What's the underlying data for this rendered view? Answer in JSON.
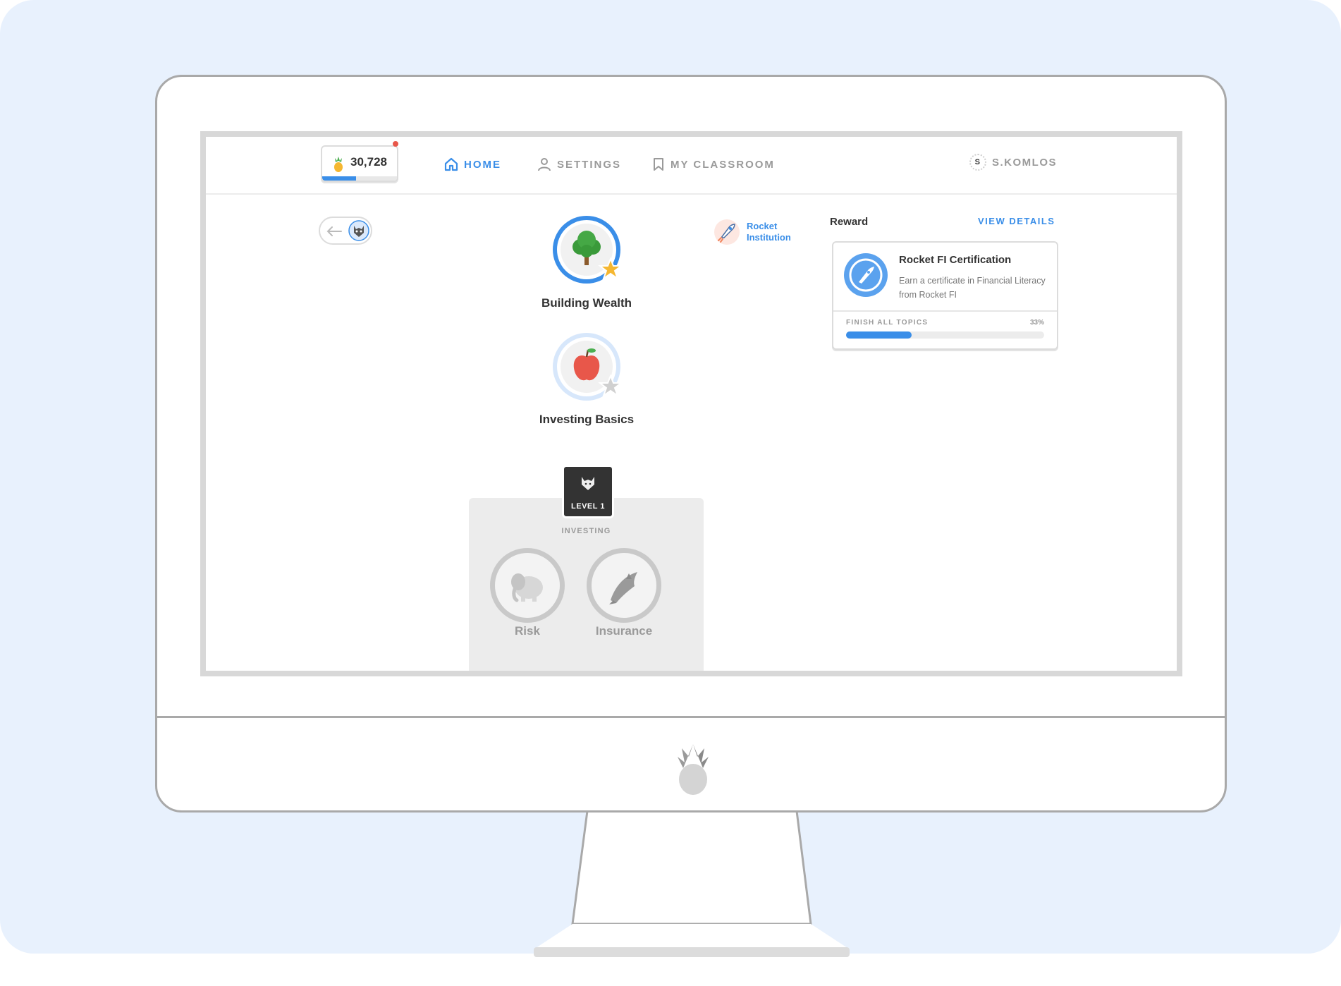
{
  "header": {
    "points": "30,728",
    "points_progress": 0.45,
    "nav": [
      {
        "label": "HOME",
        "icon": "home-icon",
        "active": true
      },
      {
        "label": "SETTINGS",
        "icon": "user-icon",
        "active": false
      },
      {
        "label": "MY CLASSROOM",
        "icon": "bookmark-icon",
        "active": false
      }
    ],
    "user": {
      "initial": "S",
      "name": "S.KOMLOS"
    }
  },
  "path": {
    "nodes": [
      {
        "label": "Building Wealth",
        "icon": "tree-icon",
        "status": "completed"
      },
      {
        "label": "Investing Basics",
        "icon": "apple-icon",
        "status": "in-progress"
      }
    ]
  },
  "institution": {
    "line1": "Rocket",
    "line2": "Institution"
  },
  "reward": {
    "title": "Reward",
    "view_details": "VIEW DETAILS",
    "card_title": "Rocket FI Certification",
    "card_desc": "Earn a certificate in Financial Literacy from Rocket FI",
    "progress_label": "FINISH ALL TOPICS",
    "progress_pct": "33%",
    "progress_value": 0.33
  },
  "level": {
    "badge": "LEVEL 1",
    "category": "INVESTING",
    "lessons": [
      {
        "label": "Risk",
        "icon": "elephant-icon"
      },
      {
        "label": "Insurance",
        "icon": "dolphin-icon"
      }
    ]
  },
  "colors": {
    "accent": "#3a8ee8",
    "background": "#e8f1fd",
    "star": "#f5b731"
  }
}
